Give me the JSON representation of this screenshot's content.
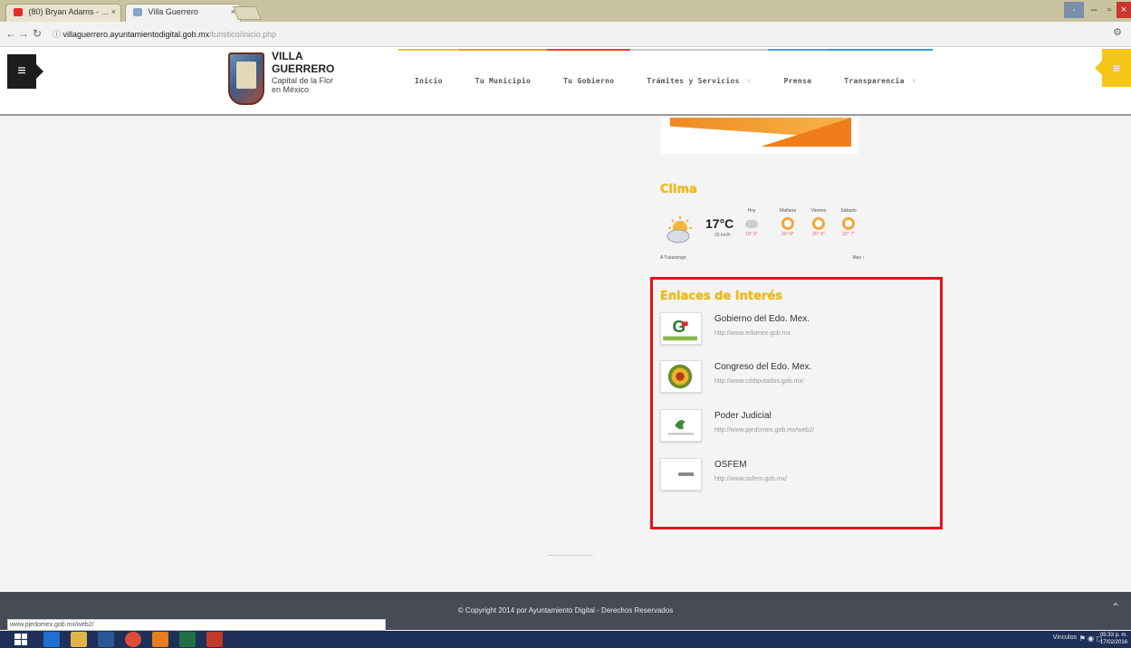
{
  "browser": {
    "tabs": [
      {
        "label": "(80) Bryan Adams - …",
        "active": false
      },
      {
        "label": "Villa Guerrero",
        "active": true
      }
    ],
    "url_host": "villaguerrero.ayuntamientodigital.gob.mx",
    "url_path": "/turistico/inicio.php",
    "status_url": "www.pjedomex.gob.mx/web2/"
  },
  "header": {
    "logo": {
      "line1": "VILLA",
      "line2": "GUERRERO",
      "line3": "Capital de la Flor",
      "line4": "en México"
    },
    "nav": [
      {
        "label": "Inicio",
        "accent": "#f2c12e",
        "dropdown": false
      },
      {
        "label": "Tu Municipio",
        "accent": "#f39a1e",
        "dropdown": false
      },
      {
        "label": "Tu Gobierno",
        "accent": "#e8412f",
        "dropdown": false
      },
      {
        "label": "Trámites y Servicios",
        "accent": "#c8c8c8",
        "dropdown": true
      },
      {
        "label": "Prensa",
        "accent": "#3fa9d8",
        "dropdown": false
      },
      {
        "label": "Transparencia",
        "accent": "#2aa2c8",
        "dropdown": true
      }
    ],
    "dropdown_caret": "˅"
  },
  "clima": {
    "title": "Clima",
    "current_temp": "17°C",
    "wind": "29 km/h",
    "forecast": [
      {
        "day": "Hoy",
        "temp": "19° 5°",
        "icon": "cloud"
      },
      {
        "day": "Mañana",
        "temp": "20° 8°",
        "icon": "sun"
      },
      {
        "day": "Viernes",
        "temp": "20° 8°",
        "icon": "sun"
      },
      {
        "day": "Sábado",
        "temp": "20° 7°",
        "icon": "sun"
      }
    ],
    "location": "A Tulancingo",
    "more": "Mas ›"
  },
  "enlaces": {
    "title": "Enlaces de Interés",
    "items": [
      {
        "name": "Gobierno del Edo. Mex.",
        "url": "http://www.edomex.gob.mx"
      },
      {
        "name": "Congreso del Edo. Mex.",
        "url": "http://www.cddiputados.gob.mx/"
      },
      {
        "name": "Poder Judicial",
        "url": "http://www.pjedomex.gob.mx/web2/"
      },
      {
        "name": "OSFEM",
        "url": "http://www.osfem.gob.mx/"
      }
    ]
  },
  "footer": {
    "copyright": "© Copyright 2014 por Ayuntamiento Digital - Derechos Reservados"
  },
  "taskbar": {
    "tray_text": "Vinculos",
    "clock_time": "05:33 p. m.",
    "clock_date": "17/02/2016"
  },
  "colors": {
    "accent_yellow": "#f0bd17",
    "highlight_red": "#e8101b",
    "footer_bg": "#464b55"
  }
}
